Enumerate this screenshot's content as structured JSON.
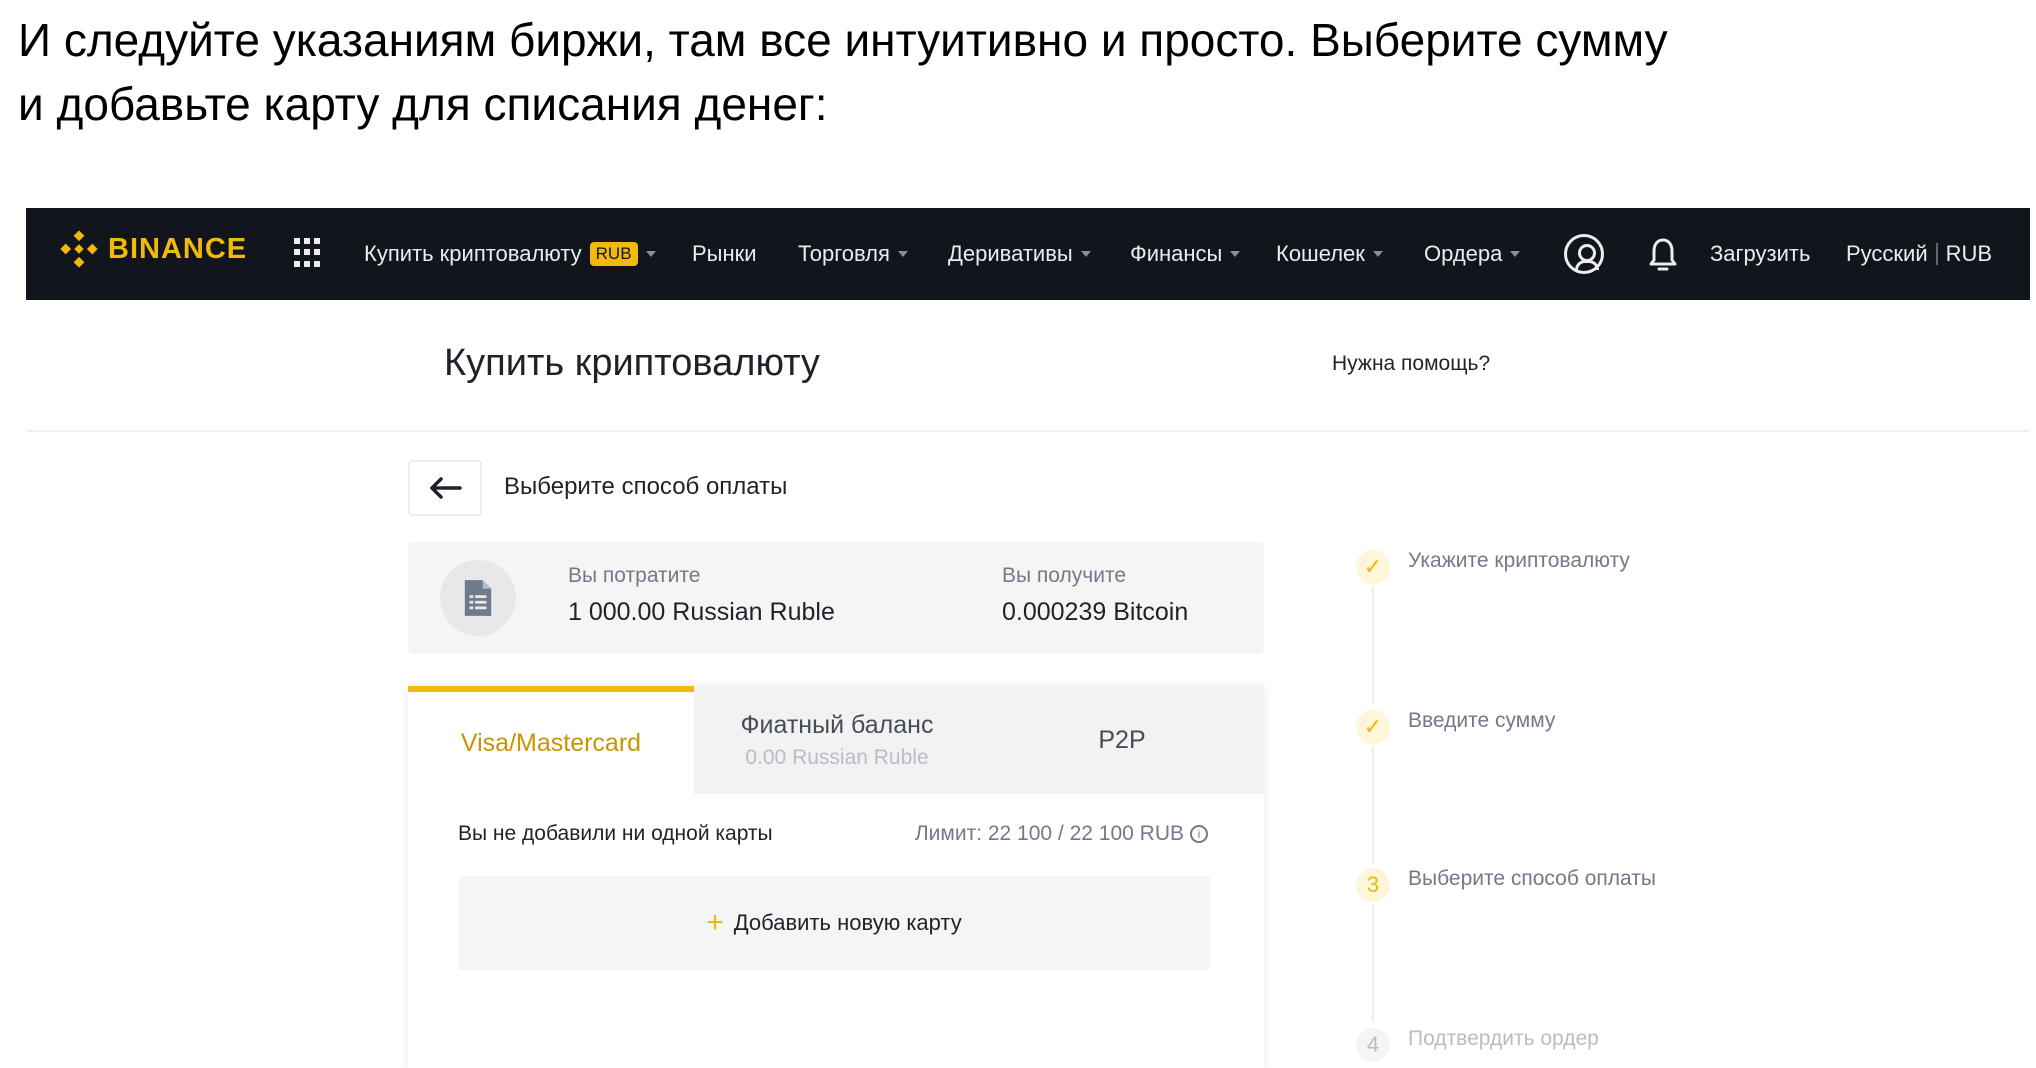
{
  "intro": {
    "line1": "И следуйте указаниям биржи, там все интуитивно и просто. Выберите сумму",
    "line2": "и добавьте карту для списания денег:"
  },
  "nav": {
    "logo": "BINANCE",
    "items": [
      {
        "label": "Купить криптовалюту",
        "badge": "RUB"
      },
      {
        "label": "Рынки"
      },
      {
        "label": "Торговля"
      },
      {
        "label": "Деривативы"
      },
      {
        "label": "Финансы"
      },
      {
        "label": "Кошелек"
      },
      {
        "label": "Ордера"
      }
    ],
    "download": "Загрузить",
    "language": "Русский",
    "currency": "RUB",
    "brand_color": "#f0b90b"
  },
  "page": {
    "title": "Купить криптовалюту",
    "help": "Нужна помощь?",
    "back_label": "Выберите способ оплаты"
  },
  "summary": {
    "spend_label": "Вы потратите",
    "spend_value": "1 000.00 Russian Ruble",
    "receive_label": "Вы получите",
    "receive_value": "0.000239 Bitcoin"
  },
  "payment": {
    "tabs": [
      {
        "label": "Visa/Mastercard",
        "sub": ""
      },
      {
        "label": "Фиатный баланс",
        "sub": "0.00 Russian Ruble"
      },
      {
        "label": "P2P",
        "sub": ""
      }
    ],
    "no_cards": "Вы не добавили ни одной карты",
    "limit": "Лимит: 22 100 / 22 100 RUB",
    "add_card": "Добавить новую карту"
  },
  "steps": [
    {
      "marker": "✓",
      "label": "Укажите криптовалюту",
      "state": "done"
    },
    {
      "marker": "✓",
      "label": "Введите сумму",
      "state": "done"
    },
    {
      "marker": "3",
      "label": "Выберите способ оплаты",
      "state": "current"
    },
    {
      "marker": "4",
      "label": "Подтвердить ордер",
      "state": "future"
    }
  ]
}
